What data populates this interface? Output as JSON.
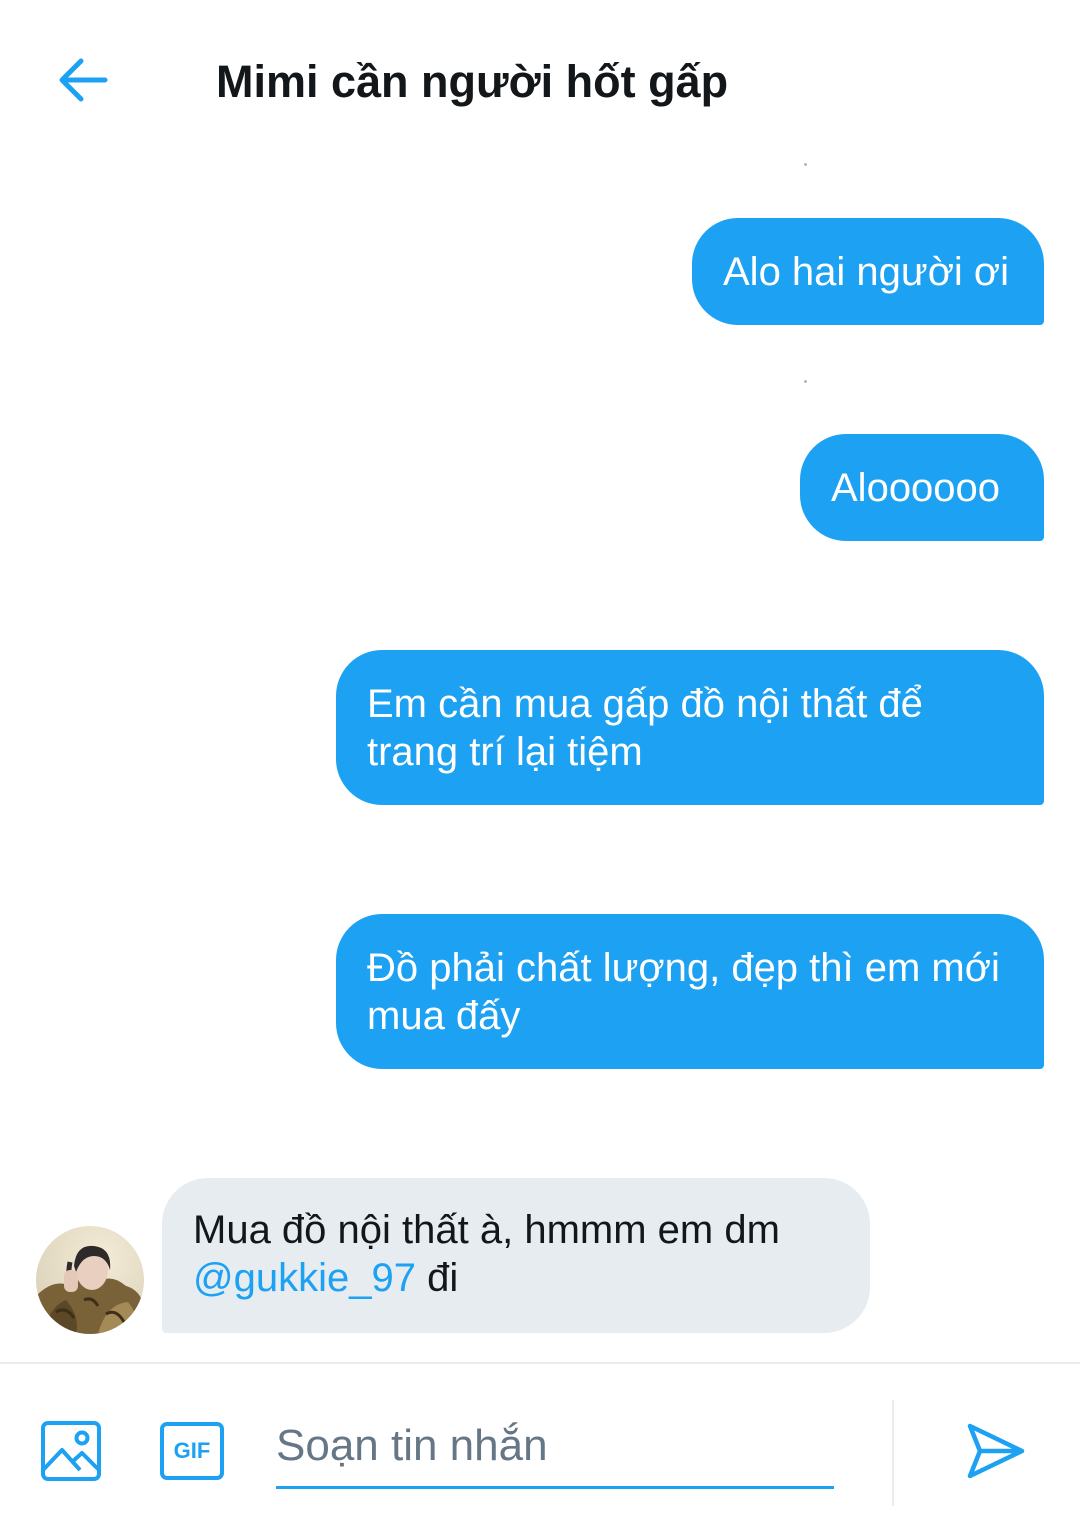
{
  "header": {
    "title": "Mimi cần người hốt gấp",
    "back_icon": "arrow-left-icon"
  },
  "colors": {
    "accent": "#1da1f2",
    "incoming_bubble": "#e6ecf0",
    "text_dark": "#14171a"
  },
  "messages": [
    {
      "direction": "out",
      "text": "Alo hai người ơi"
    },
    {
      "direction": "out",
      "text": "Aloooooo"
    },
    {
      "direction": "out",
      "text": "Em cần mua gấp đồ nội thất để trang trí lại tiệm"
    },
    {
      "direction": "out",
      "text": "Đồ phải chất lượng, đẹp thì em mới mua đấy"
    },
    {
      "direction": "in",
      "text_before": "Mua đồ nội thất à, hmmm em dm",
      "mention": "@gukkie_97",
      "text_after": " đi"
    }
  ],
  "composer": {
    "placeholder": "Soạn tin nhắn",
    "value": "",
    "image_icon": "image-icon",
    "gif_label": "GIF",
    "send_icon": "send-icon"
  }
}
